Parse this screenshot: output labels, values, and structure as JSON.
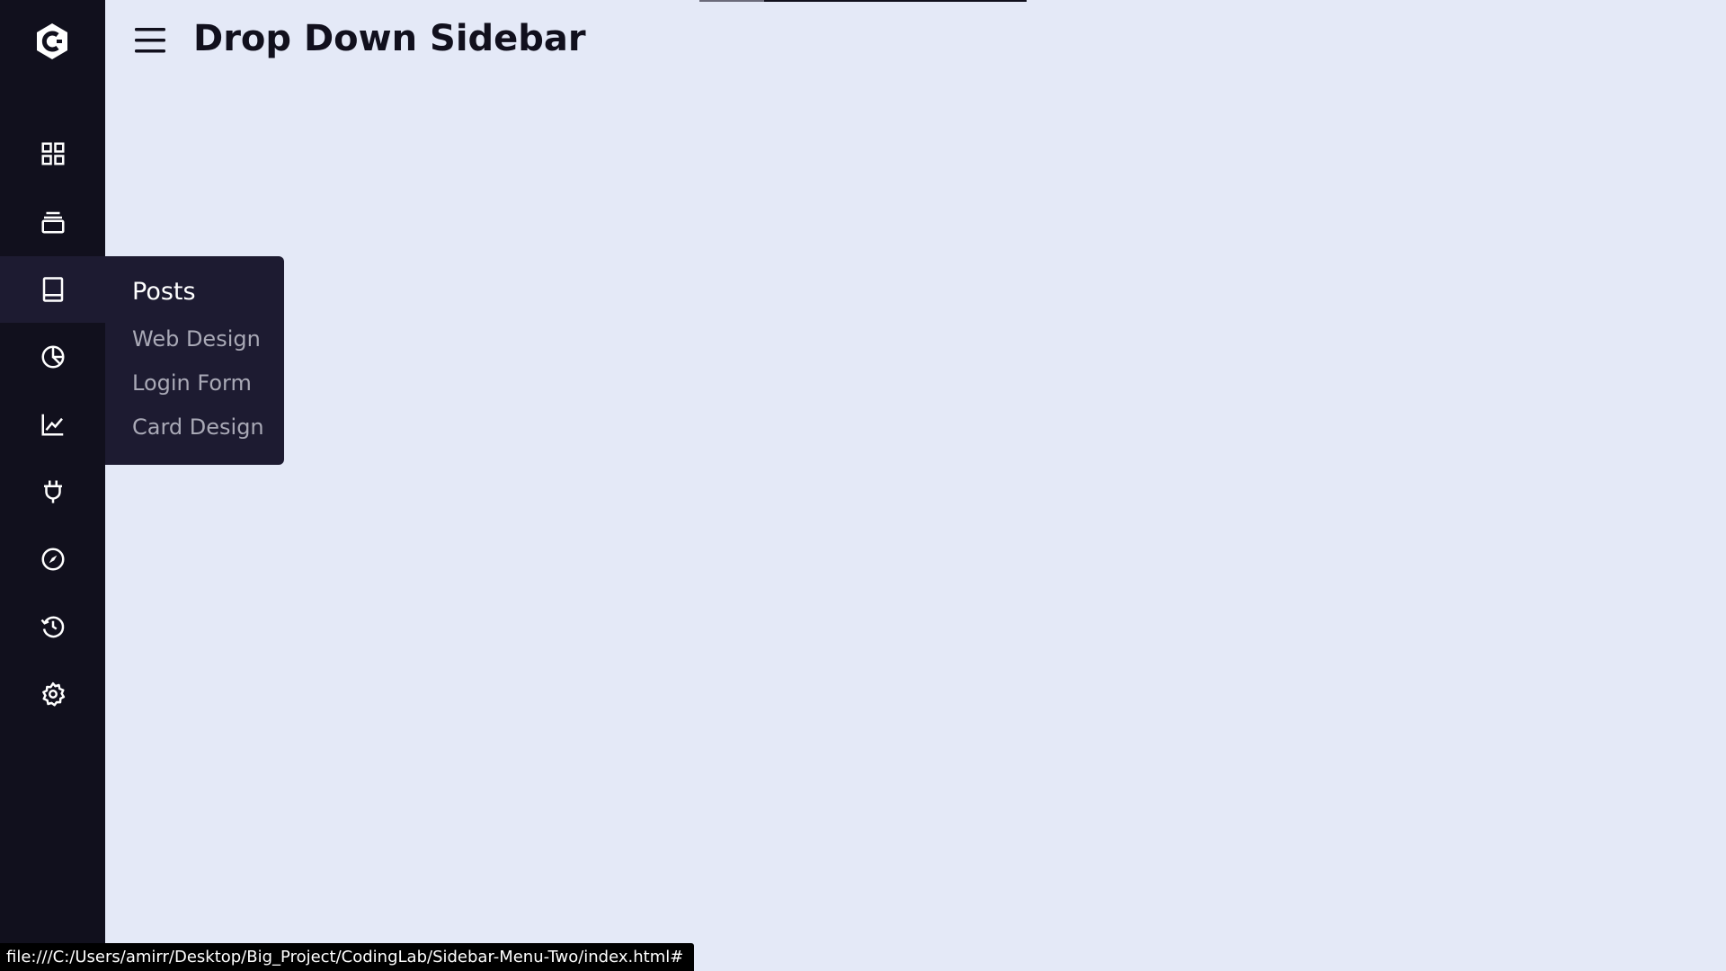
{
  "app": {
    "title": "Drop Down Sidebar"
  },
  "sidebar": {
    "logo_icon": "c-hexagon-logo-icon",
    "items": [
      {
        "icon": "grid-icon",
        "active": false
      },
      {
        "icon": "collection-icon",
        "active": false
      },
      {
        "icon": "book-icon",
        "active": true
      },
      {
        "icon": "pie-chart-icon",
        "active": false
      },
      {
        "icon": "line-chart-icon",
        "active": false
      },
      {
        "icon": "plug-icon",
        "active": false
      },
      {
        "icon": "compass-icon",
        "active": false
      },
      {
        "icon": "history-icon",
        "active": false
      },
      {
        "icon": "gear-icon",
        "active": false
      }
    ]
  },
  "flyout": {
    "title": "Posts",
    "links": [
      "Web Design",
      "Login Form",
      "Card Design"
    ]
  },
  "header": {
    "menu_icon": "hamburger-menu-icon"
  },
  "status_bar": {
    "url": "file:///C:/Users/amirr/Desktop/Big_Project/CodingLab/Sidebar-Menu-Two/index.html#"
  },
  "colors": {
    "sidebar_bg": "#11101d",
    "active_bg": "#1d1b31",
    "page_bg": "#e4e9f7",
    "muted_text": "#a9a9b6",
    "white": "#ffffff"
  }
}
